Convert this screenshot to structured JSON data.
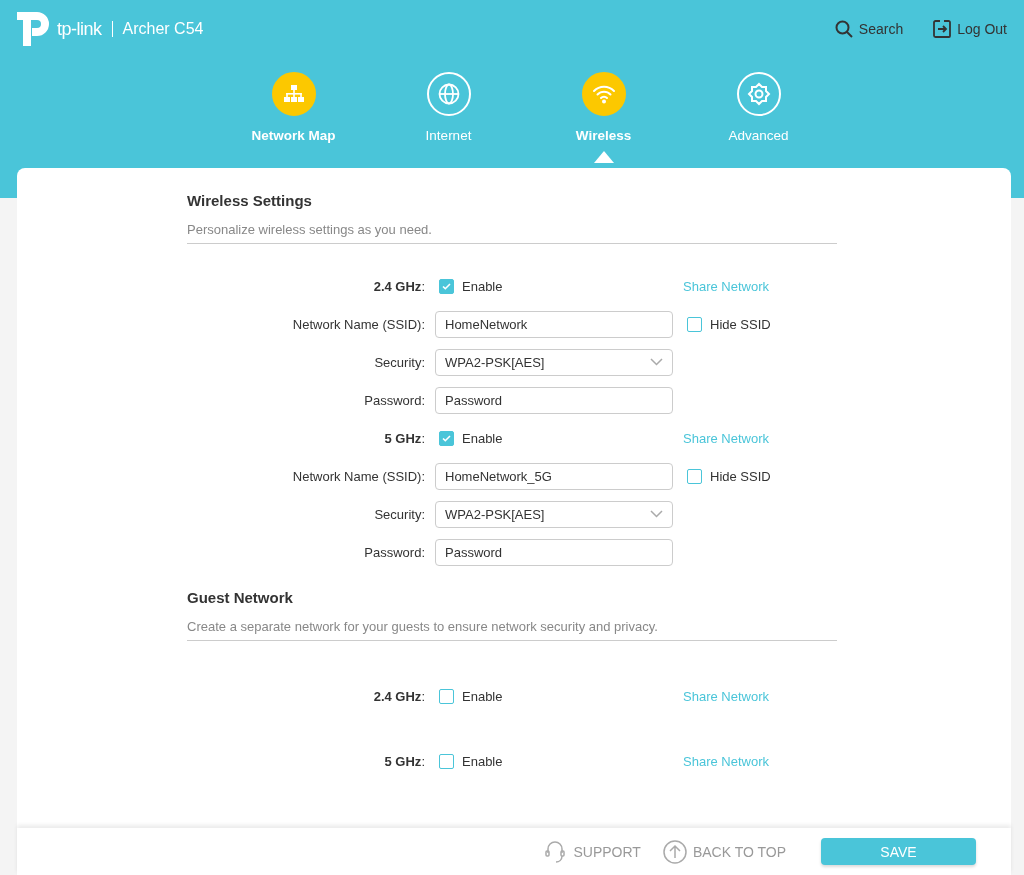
{
  "header": {
    "brand": "tp-link",
    "model": "Archer C54",
    "search": "Search",
    "logout": "Log Out"
  },
  "nav": [
    {
      "label": "Network Map",
      "highlighted": true,
      "selected": false
    },
    {
      "label": "Internet",
      "highlighted": false,
      "selected": false
    },
    {
      "label": "Wireless",
      "highlighted": true,
      "selected": true
    },
    {
      "label": "Advanced",
      "highlighted": false,
      "selected": false
    }
  ],
  "sections": [
    {
      "title": "Wireless Settings",
      "description": "Personalize wireless settings as you need.",
      "rows": [
        {
          "kind": "band",
          "label": "**2.4 GHz**:",
          "option": "Enable",
          "checked": true,
          "link": "Share Network"
        },
        {
          "kind": "text",
          "label": "Network Name (SSID):",
          "value": "HomeNetwork",
          "option": "Hide SSID",
          "checked": false
        },
        {
          "kind": "select",
          "label": "Security:",
          "value": "WPA2-PSK[AES]"
        },
        {
          "kind": "text",
          "label": "Password:",
          "value": "Password"
        },
        {
          "kind": "band",
          "label": "**5 GHz**:",
          "option": "Enable",
          "checked": true,
          "link": "Share Network"
        },
        {
          "kind": "text",
          "label": "Network Name (SSID):",
          "value": "HomeNetwork_5G",
          "option": "Hide SSID",
          "checked": false
        },
        {
          "kind": "select",
          "label": "Security:",
          "value": "WPA2-PSK[AES]"
        },
        {
          "kind": "text",
          "label": "Password:",
          "value": "Password"
        }
      ]
    },
    {
      "title": "Guest Network",
      "description": "Create a separate network for your guests to ensure network security and privacy.",
      "rows": [
        {
          "kind": "band",
          "label": "**2.4 GHz**:",
          "option": "Enable",
          "checked": false,
          "link": "Share Network"
        },
        {
          "kind": "band",
          "label": "**5 GHz**:",
          "option": "Enable",
          "checked": false,
          "link": "Share Network"
        }
      ]
    }
  ],
  "footer": {
    "support": "SUPPORT",
    "back_to_top": "BACK TO TOP",
    "save": "SAVE"
  }
}
